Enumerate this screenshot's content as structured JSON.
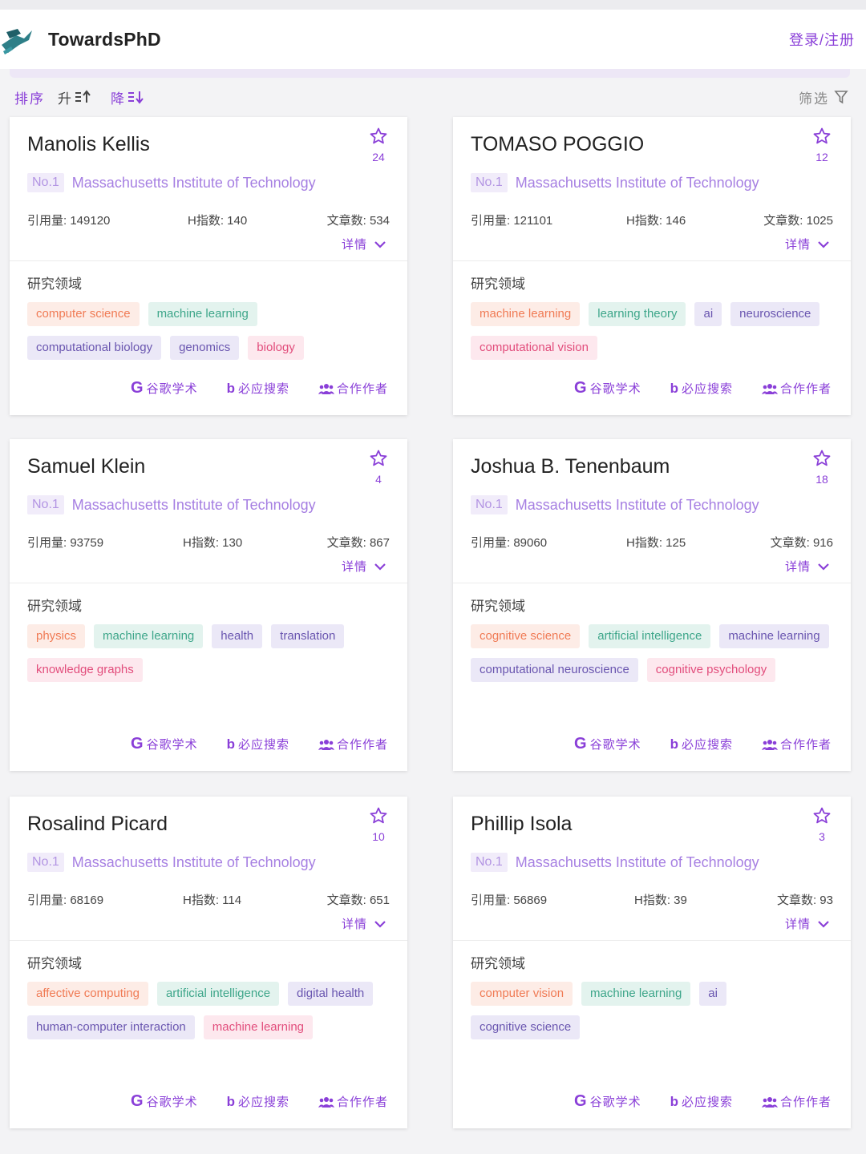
{
  "header": {
    "brand": "TowardsPhD",
    "login": "登录/注册"
  },
  "sortbar": {
    "sort_label": "排序",
    "asc_label": "升",
    "desc_label": "降",
    "filter_label": "筛选"
  },
  "card_common": {
    "fields_title": "研究领域",
    "detail_label": "详情",
    "link_scholar": "谷歌学术",
    "link_bing": "必应搜索",
    "link_coauthors": "合作作者",
    "scholar_mark": "G",
    "bing_mark": "b"
  },
  "cards": [
    {
      "name": "Manolis Kellis",
      "stars": "24",
      "rank": "No.1",
      "institution": "Massachusetts Institute of Technology",
      "citations": "引用量: 149120",
      "h_index": "H指数: 140",
      "papers": "文章数: 534",
      "fields": [
        {
          "label": "computer science",
          "color": "orange"
        },
        {
          "label": "machine learning",
          "color": "green"
        },
        {
          "label": "computational biology",
          "color": "purple"
        },
        {
          "label": "genomics",
          "color": "purple"
        },
        {
          "label": "biology",
          "color": "pink"
        }
      ]
    },
    {
      "name": "TOMASO POGGIO",
      "stars": "12",
      "rank": "No.1",
      "institution": "Massachusetts Institute of Technology",
      "citations": "引用量: 121101",
      "h_index": "H指数: 146",
      "papers": "文章数: 1025",
      "fields": [
        {
          "label": "machine learning",
          "color": "orange"
        },
        {
          "label": "learning theory",
          "color": "green"
        },
        {
          "label": "ai",
          "color": "purple"
        },
        {
          "label": "neuroscience",
          "color": "purple"
        },
        {
          "label": "computational vision",
          "color": "pink"
        }
      ]
    },
    {
      "name": "Samuel Klein",
      "stars": "4",
      "rank": "No.1",
      "institution": "Massachusetts Institute of Technology",
      "citations": "引用量: 93759",
      "h_index": "H指数: 130",
      "papers": "文章数: 867",
      "fields": [
        {
          "label": "physics",
          "color": "orange"
        },
        {
          "label": "machine learning",
          "color": "green"
        },
        {
          "label": "health",
          "color": "purple"
        },
        {
          "label": "translation",
          "color": "purple"
        },
        {
          "label": "knowledge graphs",
          "color": "pink"
        }
      ]
    },
    {
      "name": "Joshua B. Tenenbaum",
      "stars": "18",
      "rank": "No.1",
      "institution": "Massachusetts Institute of Technology",
      "citations": "引用量: 89060",
      "h_index": "H指数: 125",
      "papers": "文章数: 916",
      "fields": [
        {
          "label": "cognitive science",
          "color": "orange"
        },
        {
          "label": "artificial intelligence",
          "color": "green"
        },
        {
          "label": "machine learning",
          "color": "purple"
        },
        {
          "label": "computational neuroscience",
          "color": "purple"
        },
        {
          "label": "cognitive psychology",
          "color": "pink"
        }
      ]
    },
    {
      "name": "Rosalind Picard",
      "stars": "10",
      "rank": "No.1",
      "institution": "Massachusetts Institute of Technology",
      "citations": "引用量: 68169",
      "h_index": "H指数: 114",
      "papers": "文章数: 651",
      "fields": [
        {
          "label": "affective computing",
          "color": "orange"
        },
        {
          "label": "artificial intelligence",
          "color": "green"
        },
        {
          "label": "digital health",
          "color": "purple"
        },
        {
          "label": "human-computer interaction",
          "color": "purple"
        },
        {
          "label": "machine learning",
          "color": "pink"
        }
      ]
    },
    {
      "name": "Phillip Isola",
      "stars": "3",
      "rank": "No.1",
      "institution": "Massachusetts Institute of Technology",
      "citations": "引用量: 56869",
      "h_index": "H指数: 39",
      "papers": "文章数: 93",
      "fields": [
        {
          "label": "computer vision",
          "color": "orange"
        },
        {
          "label": "machine learning",
          "color": "green"
        },
        {
          "label": "ai",
          "color": "purple"
        },
        {
          "label": "cognitive science",
          "color": "purple"
        }
      ]
    }
  ],
  "colors": {
    "accent": "#8a3fd8",
    "institution": "#a67fe2"
  }
}
